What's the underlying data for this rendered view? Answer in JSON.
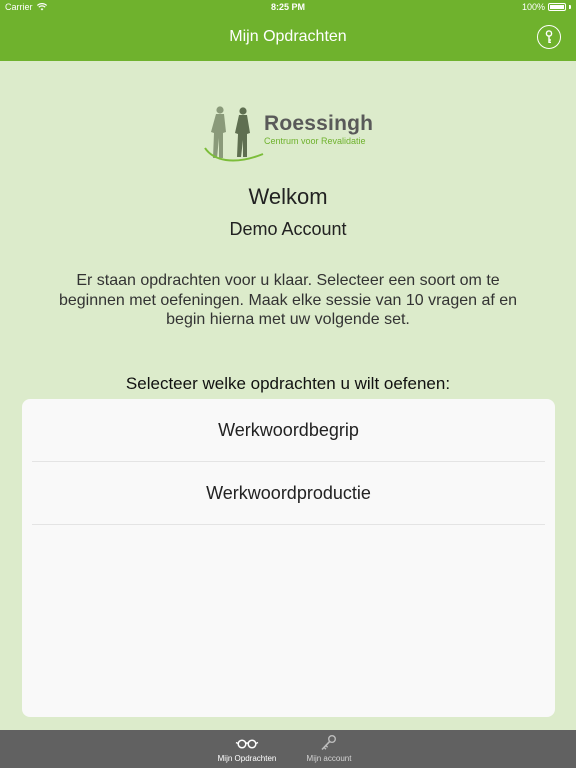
{
  "status_bar": {
    "carrier": "Carrier",
    "time": "8:25 PM",
    "battery": "100%"
  },
  "nav_bar": {
    "title": "Mijn Opdrachten",
    "action_icon": "key-icon"
  },
  "logo": {
    "name": "Roessingh",
    "subtitle": "Centrum voor Revalidatie"
  },
  "welcome": {
    "title": "Welkom",
    "account_name": "Demo Account",
    "intro": "Er staan opdrachten voor u klaar. Selecteer een soort om te beginnen met oefeningen. Maak elke sessie van 10 vragen af en begin hierna met uw volgende set."
  },
  "exercises": {
    "label": "Selecteer welke opdrachten u wilt oefenen:",
    "items": [
      {
        "label": "Werkwoordbegrip"
      },
      {
        "label": "Werkwoordproductie"
      }
    ]
  },
  "tab_bar": {
    "tabs": [
      {
        "label": "Mijn Opdrachten",
        "icon": "glasses-icon",
        "active": true
      },
      {
        "label": "Mijn account",
        "icon": "key-icon",
        "active": false
      }
    ]
  },
  "colors": {
    "accent": "#6fb22d",
    "background": "#dcebcb",
    "tab_bar": "#616161"
  }
}
